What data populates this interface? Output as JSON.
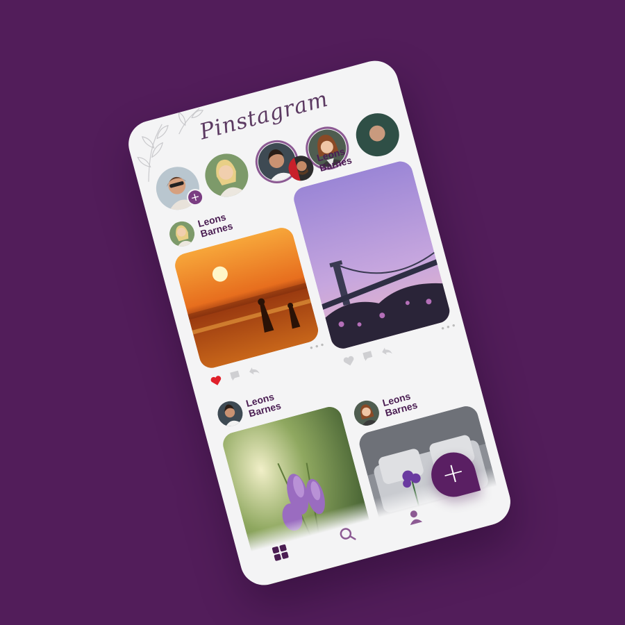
{
  "app": {
    "logo": "Pinstagram"
  },
  "colors": {
    "background": "#521d5a",
    "accent": "#7a3d82",
    "fab": "#5a1f63",
    "like": "#e0202a"
  },
  "stories": [
    {
      "name": "my-story",
      "ring": false,
      "add": true,
      "add_label": "+"
    },
    {
      "name": "story-2",
      "ring": false
    },
    {
      "name": "story-3",
      "ring": true
    },
    {
      "name": "story-4",
      "ring": true
    },
    {
      "name": "story-5",
      "ring": false
    }
  ],
  "posts": [
    {
      "author": "Leons\nBarnes",
      "photo": "sunset-beach",
      "liked": true,
      "more": "•••"
    },
    {
      "author": "Leons\nBarnes",
      "photo": "bridge-dusk",
      "liked": false,
      "more": "•••"
    },
    {
      "author": "Leons\nBarnes",
      "photo": "lavender-flowers"
    },
    {
      "author": "Leons\nBarnes",
      "photo": "living-room"
    }
  ],
  "nav": {
    "items": [
      "grid-icon",
      "search-icon",
      "profile-icon"
    ],
    "fab_label": "+"
  }
}
